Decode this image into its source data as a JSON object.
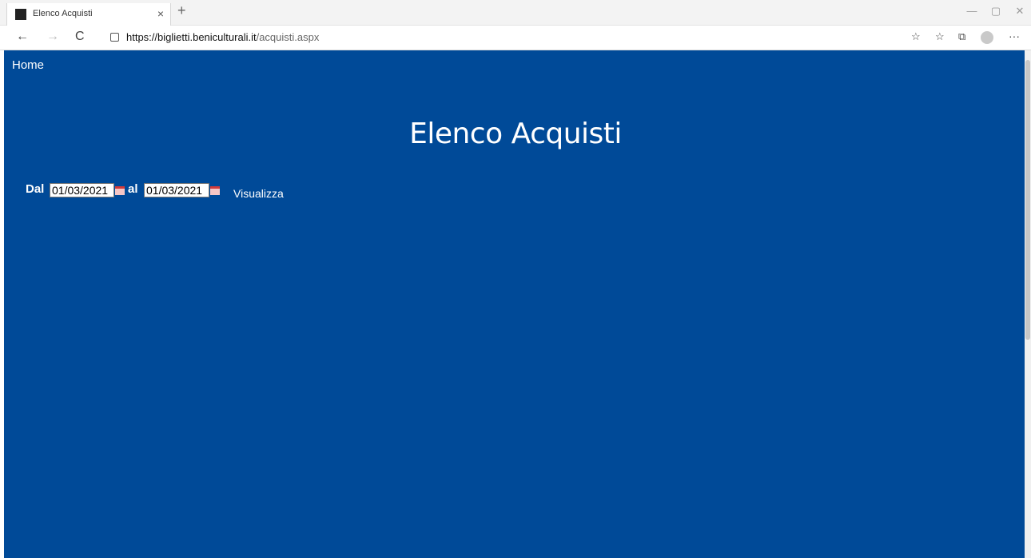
{
  "browser": {
    "tab_title": "Elenco Acquisti",
    "tab_close": "×",
    "new_tab": "+",
    "url_host": "https://biglietti.beniculturali.it",
    "url_path": "/acquisti.aspx",
    "icons": {
      "back": "←",
      "forward": "→",
      "refresh": "C",
      "favorites_add": "☆",
      "favorites": "☆",
      "collections": "⧉",
      "more": "···",
      "minimize": "—",
      "maximize": "▢",
      "close": "✕"
    }
  },
  "page": {
    "home_link": "Home",
    "title": "Elenco Acquisti",
    "filter": {
      "from_label": "Dal",
      "from_value": "01/03/2021",
      "to_label": "al",
      "to_value": "01/03/2021",
      "submit_label": "Visualizza"
    }
  },
  "colors": {
    "background": "#004a98",
    "text": "#ffffff"
  }
}
